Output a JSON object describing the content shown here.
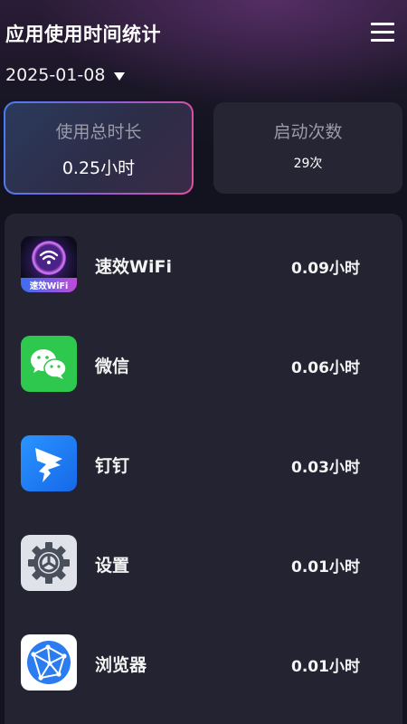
{
  "header": {
    "title": "应用使用时间统计",
    "menu_icon": "hamburger-menu-icon"
  },
  "date_selector": {
    "value": "2025-01-08",
    "icon": "caret-down-icon"
  },
  "stats": {
    "total_usage": {
      "label": "使用总时长",
      "value": "0.25小时"
    },
    "launch_count": {
      "label": "启动次数",
      "value": "29次"
    }
  },
  "apps": [
    {
      "name": "速效WiFi",
      "time": "0.09小时",
      "icon": "speed-wifi-app-icon",
      "icon_label": "速效WiFi"
    },
    {
      "name": "微信",
      "time": "0.06小时",
      "icon": "wechat-app-icon"
    },
    {
      "name": "钉钉",
      "time": "0.03小时",
      "icon": "dingtalk-app-icon"
    },
    {
      "name": "设置",
      "time": "0.01小时",
      "icon": "settings-app-icon"
    },
    {
      "name": "浏览器",
      "time": "0.01小时",
      "icon": "browser-app-icon"
    }
  ],
  "colors": {
    "background": "#131320",
    "card": "#252533",
    "panel": "#232331",
    "accent_gradient_start": "#4a7cf0",
    "accent_gradient_end": "#e0509a",
    "wechat_green": "#2dc84d",
    "dingtalk_blue": "#1a7cf5"
  }
}
